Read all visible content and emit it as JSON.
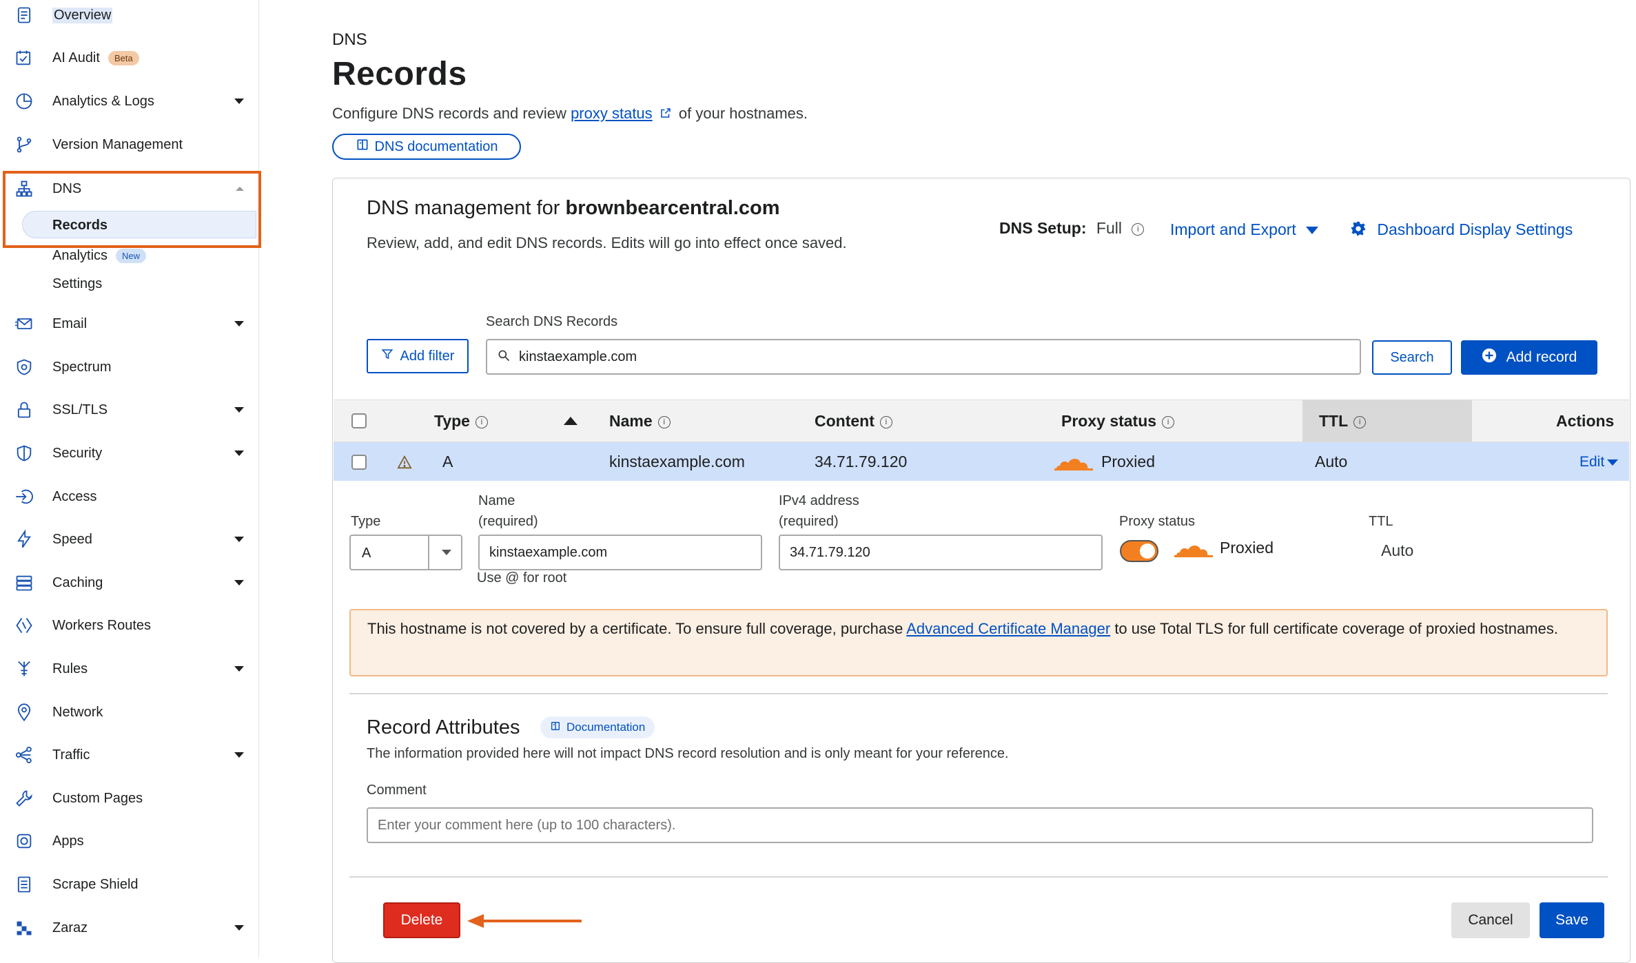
{
  "sidebar": {
    "items": [
      {
        "label": "Overview",
        "icon": "document-icon"
      },
      {
        "label": "AI Audit",
        "badge": "Beta",
        "icon": "calendar-check-icon"
      },
      {
        "label": "Analytics & Logs",
        "icon": "pie-chart-icon"
      },
      {
        "label": "Version Management",
        "icon": "branch-icon"
      },
      {
        "label": "DNS",
        "icon": "network-tree-icon"
      },
      {
        "label": "Email",
        "icon": "envelope-icon"
      },
      {
        "label": "Spectrum",
        "icon": "shield-dots-icon"
      },
      {
        "label": "SSL/TLS",
        "icon": "lock-icon"
      },
      {
        "label": "Security",
        "icon": "shield-icon"
      },
      {
        "label": "Access",
        "icon": "sign-in-icon"
      },
      {
        "label": "Speed",
        "icon": "lightning-icon"
      },
      {
        "label": "Caching",
        "icon": "server-stack-icon"
      },
      {
        "label": "Workers Routes",
        "icon": "diamond-code-icon"
      },
      {
        "label": "Rules",
        "icon": "funnel-rules-icon"
      },
      {
        "label": "Network",
        "icon": "location-pin-icon"
      },
      {
        "label": "Traffic",
        "icon": "share-nodes-icon"
      },
      {
        "label": "Custom Pages",
        "icon": "wrench-icon"
      },
      {
        "label": "Apps",
        "icon": "apps-icon"
      },
      {
        "label": "Scrape Shield",
        "icon": "document-lines-icon"
      },
      {
        "label": "Zaraz",
        "icon": "zaraz-icon"
      }
    ],
    "dns_sub": {
      "records": "Records",
      "analytics": "Analytics",
      "analytics_badge": "New",
      "settings": "Settings"
    },
    "highlight_color": "#e2621b"
  },
  "header": {
    "breadcrumb": "DNS",
    "title": "Records",
    "desc_before": "Configure DNS records and review",
    "desc_link": "proxy status",
    "desc_after": "of your hostnames.",
    "doc_button": "DNS documentation"
  },
  "card": {
    "title_prefix": "DNS management for",
    "domain": "brownbearcentral.com",
    "description": "Review, add, and edit DNS records. Edits will go into effect once saved.",
    "dns_setup_label": "DNS Setup:",
    "dns_setup_value": "Full",
    "import_export": "Import and Export",
    "dashboard_settings": "Dashboard Display Settings",
    "search_label": "Search DNS Records",
    "add_filter": "Add filter",
    "search_value": "kinstaexample.com",
    "search_button": "Search",
    "add_record": "Add record"
  },
  "table": {
    "columns": {
      "type": "Type",
      "name": "Name",
      "content": "Content",
      "proxy_status": "Proxy status",
      "ttl": "TTL",
      "actions": "Actions"
    },
    "row": {
      "type": "A",
      "name": "kinstaexample.com",
      "content": "34.71.79.120",
      "proxy_status": "Proxied",
      "ttl": "Auto",
      "action": "Edit"
    }
  },
  "edit_form": {
    "type_label": "Type",
    "type_value": "A",
    "name_label_1": "Name",
    "name_label_2": "(required)",
    "name_value": "kinstaexample.com",
    "name_hint": "Use @ for root",
    "ipv4_label_1": "IPv4 address",
    "ipv4_label_2": "(required)",
    "ipv4_value": "34.71.79.120",
    "proxy_label": "Proxy status",
    "proxy_value": "Proxied",
    "ttl_label": "TTL",
    "ttl_value": "Auto",
    "warning_before": "This hostname is not covered by a certificate. To ensure full coverage, purchase",
    "warning_link": "Advanced Certificate Manager",
    "warning_after": "to use Total TLS for full certificate coverage of proxied hostnames.",
    "attributes_title": "Record Attributes",
    "attributes_doc": "Documentation",
    "attributes_desc": "The information provided here will not impact DNS record resolution and is only meant for your reference.",
    "comment_label": "Comment",
    "comment_placeholder": "Enter your comment here (up to 100 characters).",
    "delete": "Delete",
    "cancel": "Cancel",
    "save": "Save"
  },
  "colors": {
    "accent": "#0051c3",
    "cloud_orange": "#f38020",
    "danger": "#de2c1e",
    "row_selected": "#cfe0fb"
  }
}
